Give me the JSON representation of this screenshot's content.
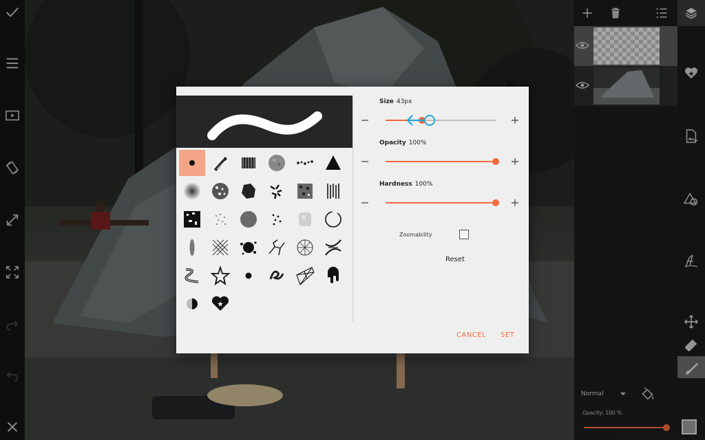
{
  "left_toolbar": {
    "items": [
      {
        "name": "check-icon"
      },
      {
        "name": "menu-icon"
      },
      {
        "name": "play-icon"
      },
      {
        "name": "rotate-icon"
      },
      {
        "name": "resize-icon"
      },
      {
        "name": "fullscreen-icon"
      },
      {
        "name": "redo-icon"
      },
      {
        "name": "undo-icon"
      },
      {
        "name": "close-icon"
      }
    ]
  },
  "right_panel": {
    "header_icons": [
      "add-layer-icon",
      "delete-layer-icon",
      "layer-menu-icon",
      "layers-icon"
    ],
    "tools": [
      "sticker-heart-icon",
      "add-image-icon",
      "shapes-icon",
      "text-icon",
      "move-icon",
      "eraser-icon",
      "brush-icon"
    ],
    "blend_mode": "Normal",
    "opacity_label": "Opacity:",
    "opacity_value": "100 %",
    "opacity_fraction": 1.0
  },
  "dialog": {
    "size": {
      "label": "Size",
      "value": "43px",
      "fraction": 0.33
    },
    "opacity": {
      "label": "Opacity",
      "value": "100%",
      "fraction": 1.0
    },
    "hardness": {
      "label": "Hardness",
      "value": "100%",
      "fraction": 1.0
    },
    "zoomability_label": "Zoomability",
    "zoomability_checked": false,
    "reset_label": "Reset",
    "cancel_label": "CANCEL",
    "set_label": "SET",
    "accent_color": "#f06a3c",
    "selected_brush_color": "#f4a588",
    "selected_brush_index": 0
  }
}
